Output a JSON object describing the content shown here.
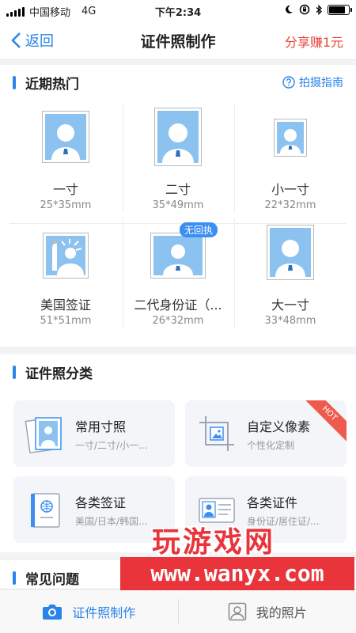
{
  "status_bar": {
    "carrier": "中国移动",
    "network": "4G",
    "time": "下午2:34",
    "battery_level": 0.75
  },
  "nav": {
    "back_label": "返回",
    "title": "证件照制作",
    "share_label": "分享赚1元"
  },
  "recent": {
    "title": "近期热门",
    "guide_label": "拍摄指南",
    "items": [
      {
        "name": "一寸",
        "size": "25*35mm"
      },
      {
        "name": "二寸",
        "size": "35*49mm"
      },
      {
        "name": "小一寸",
        "size": "22*32mm"
      },
      {
        "name": "美国签证",
        "size": "51*51mm"
      },
      {
        "name": "二代身份证（...",
        "size": "26*32mm",
        "badge": "无回执"
      },
      {
        "name": "大一寸",
        "size": "33*48mm"
      }
    ]
  },
  "category": {
    "title": "证件照分类",
    "cards": [
      {
        "title": "常用寸照",
        "subtitle": "一寸/二寸/小一..."
      },
      {
        "title": "自定义像素",
        "subtitle": "个性化定制",
        "hot": "HOT"
      },
      {
        "title": "各类签证",
        "subtitle": "美国/日本/韩国..."
      },
      {
        "title": "各类证件",
        "subtitle": "身份证/居住证/..."
      }
    ]
  },
  "faq": {
    "title": "常见问题"
  },
  "tabs": [
    {
      "label": "证件照制作",
      "active": true
    },
    {
      "label": "我的照片",
      "active": false
    }
  ],
  "watermark": {
    "top": "玩游戏网",
    "bottom": "www.wanyx.com"
  },
  "colors": {
    "accent": "#2a84e8",
    "share": "#e8453c",
    "photo_bg": "#8cc2f0"
  }
}
